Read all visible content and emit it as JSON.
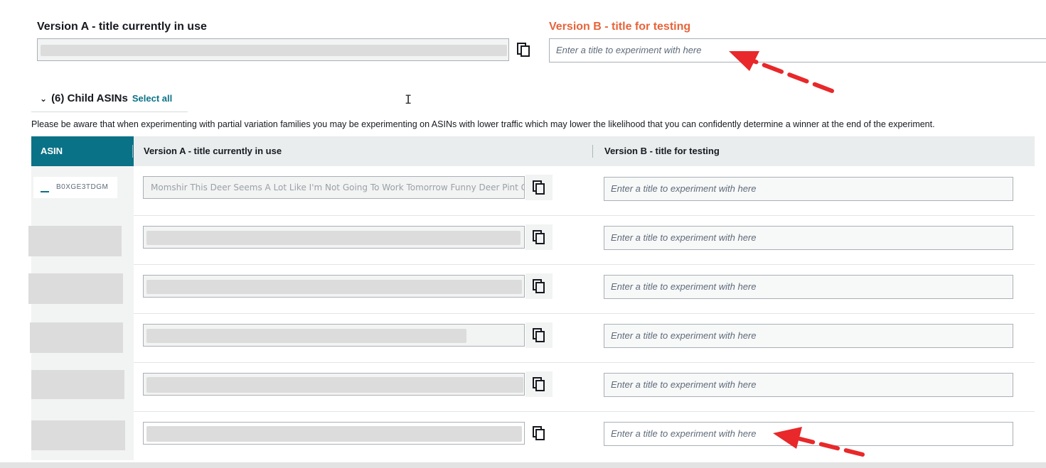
{
  "top": {
    "version_a_label": "Version A - title currently in use",
    "version_b_label": "Version B - title for testing",
    "version_b_placeholder": "Enter a title to experiment with here"
  },
  "child_asins": {
    "header": "(6) Child ASINs",
    "select_all": "Select all",
    "notice": "Please be aware that when experimenting with partial variation families you may be experimenting on ASINs with lower traffic which may lower the likelihood that you can confidently determine a winner at the end of the experiment."
  },
  "table": {
    "columns": {
      "asin": "ASIN",
      "version_a": "Version A - title currently in use",
      "version_b": "Version B - title for testing"
    },
    "rows": [
      {
        "asin": "B0XGE3TDGM",
        "current_title": "Momshir This Deer Seems A Lot Like I'm Not Going To Work Tomorrow Funny Deer Pint Gi",
        "placeholder": "Enter a title to experiment with here"
      },
      {
        "placeholder": "Enter a title to experiment with here"
      },
      {
        "placeholder": "Enter a title to experiment with here"
      },
      {
        "placeholder": "Enter a title to experiment with here"
      },
      {
        "placeholder": "Enter a title to experiment with here"
      },
      {
        "placeholder": "Enter a title to experiment with here"
      }
    ]
  },
  "colors": {
    "accent_teal": "#0a7286",
    "version_b_orange": "#e8633a",
    "annotation_red": "#e8282a"
  }
}
